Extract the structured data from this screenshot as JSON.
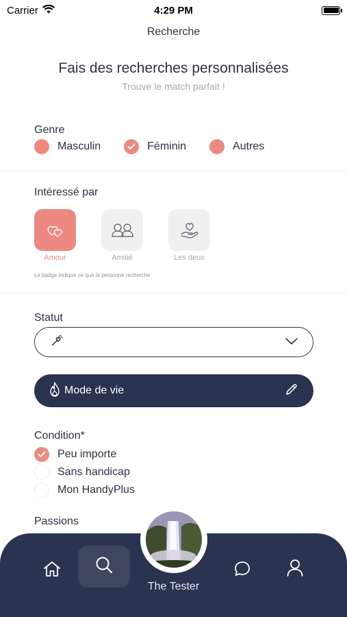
{
  "status_bar": {
    "carrier": "Carrier",
    "time": "4:29 PM"
  },
  "nav": {
    "title": "Recherche"
  },
  "header": {
    "title": "Fais des recherches personnalisées",
    "subtitle": "Trouve le match parfait !"
  },
  "genre": {
    "label": "Genre",
    "options": [
      {
        "label": "Masculin",
        "checked": false
      },
      {
        "label": "Féminin",
        "checked": true
      },
      {
        "label": "Autres",
        "checked": false
      }
    ]
  },
  "interest": {
    "label": "Intéressé par",
    "options": [
      {
        "label": "Amour",
        "icon": "hearts-icon",
        "active": true
      },
      {
        "label": "Amitié",
        "icon": "friends-icon",
        "active": false
      },
      {
        "label": "Les deux",
        "icon": "heart-hand-icon",
        "active": false
      }
    ],
    "hint": "Le badge indique ce que la personne recherche"
  },
  "statut": {
    "label": "Statut",
    "icon": "pin-heart-icon",
    "value": ""
  },
  "mode_de_vie": {
    "label": "Mode de vie",
    "icon": "flame-icon",
    "edit_icon": "pencil-icon"
  },
  "condition": {
    "label": "Condition*",
    "options": [
      {
        "label": "Peu importe",
        "checked": true
      },
      {
        "label": "Sans handicap",
        "checked": false
      },
      {
        "label": "Mon HandyPlus",
        "checked": false
      }
    ]
  },
  "passions": {
    "label": "Passions"
  },
  "tabbar": {
    "items": [
      "home-icon",
      "search-icon",
      "chat-icon",
      "profile-icon"
    ],
    "active": "search-icon",
    "user_name": "The Tester"
  },
  "colors": {
    "accent": "#ec8a82",
    "dark": "#2a3350",
    "text": "#2a3142",
    "muted": "#a4a8b0"
  }
}
